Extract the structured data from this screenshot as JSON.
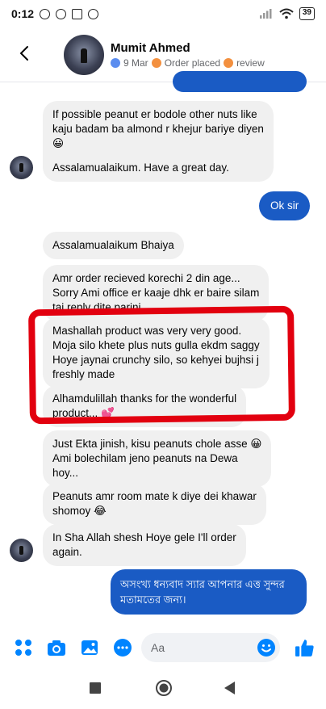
{
  "status_bar": {
    "time": "0:12",
    "battery": "39"
  },
  "header": {
    "contact_name": "Mumit Ahmed",
    "meta": {
      "date": "9 Mar",
      "status": "Order placed",
      "label": "review"
    }
  },
  "messages": [
    {
      "id": "m1",
      "direction": "incoming",
      "lines": [
        "If possible peanut er bodole other nuts like",
        "kaju badam ba almond r khejur bariye diyen",
        "😀",
        "",
        "Assalamualaikum. Have a great day."
      ]
    },
    {
      "id": "m2",
      "direction": "outgoing",
      "lines": [
        "Ok sir"
      ]
    },
    {
      "id": "m3",
      "direction": "incoming",
      "lines": [
        "Assalamualaikum Bhaiya"
      ]
    },
    {
      "id": "m4",
      "direction": "incoming",
      "lines": [
        "Amr order recieved korechi 2 din age...",
        "Sorry Ami office er kaaje dhk er baire silam",
        "tai reply dite parini"
      ]
    },
    {
      "id": "m5",
      "direction": "incoming",
      "lines": [
        "Mashallah product was very very good.",
        "Moja silo khete plus nuts gulla ekdm saggy",
        "Hoye jaynai crunchy silo, so kehyei bujhsi j",
        "freshly made"
      ]
    },
    {
      "id": "m6",
      "direction": "incoming",
      "lines": [
        "Alhamdulillah thanks for the wonderful",
        "product... 💕"
      ]
    },
    {
      "id": "m7",
      "direction": "incoming",
      "lines": [
        "Just Ekta jinish, kisu peanuts chole asse 😀",
        "Ami bolechilam jeno peanuts na Dewa",
        "hoy..."
      ]
    },
    {
      "id": "m8",
      "direction": "incoming",
      "lines": [
        "Peanuts amr room mate k diye dei khawar",
        "shomoy 😂"
      ]
    },
    {
      "id": "m9",
      "direction": "incoming",
      "lines": [
        "In Sha Allah shesh Hoye gele I'll order",
        "again."
      ]
    },
    {
      "id": "m10",
      "direction": "outgoing",
      "lines": [
        "অসংখ্য ধন্যবাদ স্যার আপনার এত্ত সুন্দর",
        "মতামতের জন্য।"
      ]
    }
  ],
  "composer": {
    "placeholder": "Aa"
  },
  "icons": {
    "back": "back-arrow-icon",
    "menu": "four-dots-icon",
    "camera": "camera-icon",
    "gallery": "image-icon",
    "voice": "messenger-icon",
    "emoji": "emoji-icon",
    "like": "thumbs-up-icon"
  },
  "colors": {
    "accent": "#0084ff",
    "outgoing_bubble": "#1a5bc4",
    "annotation": "#e2000f"
  }
}
